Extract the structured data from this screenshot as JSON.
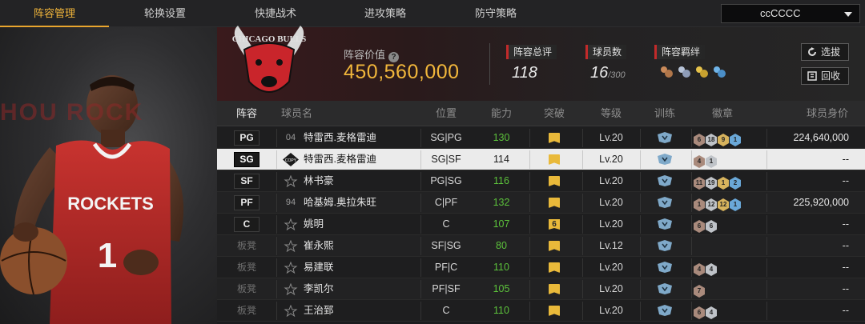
{
  "nav": {
    "tabs": [
      {
        "label": "阵容管理",
        "active": true
      },
      {
        "label": "轮换设置",
        "active": false
      },
      {
        "label": "快捷战术",
        "active": false
      },
      {
        "label": "进攻策略",
        "active": false
      },
      {
        "label": "防守策略",
        "active": false
      }
    ],
    "team_select": "ccCCCC"
  },
  "player_panel": {
    "jersey_team": "ROCKETS",
    "jersey_number": "1",
    "bg_text": "HOU  ROCK"
  },
  "header": {
    "logo_text": "CHICAGO BULLS",
    "lineup_value_label": "阵容价值",
    "lineup_value": "450,560,000",
    "rating_label": "阵容总评",
    "rating_value": "118",
    "players_label": "球员数",
    "players_value": "16",
    "players_max": "/300",
    "chemistry_label": "阵容羁绊",
    "chemistry_icons": [
      "chem-icon-1",
      "chem-icon-2",
      "chem-icon-3",
      "chem-icon-4"
    ],
    "buttons": {
      "select": "选拔",
      "recycle": "回收"
    }
  },
  "table": {
    "headers": [
      "阵容",
      "球员名",
      "位置",
      "能力",
      "突破",
      "等级",
      "训练",
      "徽章",
      "球员身价"
    ],
    "rows": [
      {
        "slot": "PG",
        "starter": true,
        "num": "04",
        "name": "特雷西.麦格雷迪",
        "position": "SG|PG",
        "ability": "130",
        "ability_green": true,
        "breakthrough": "",
        "level": "Lv.20",
        "badges": [
          {
            "t": "bronze",
            "v": "6"
          },
          {
            "t": "silver",
            "v": "18"
          },
          {
            "t": "gold",
            "v": "9"
          },
          {
            "t": "blue",
            "v": "1"
          }
        ],
        "salary": "224,640,000"
      },
      {
        "slot": "SG",
        "starter": true,
        "num": "COPY",
        "name": "特雷西.麦格雷迪",
        "position": "SG|SF",
        "ability": "114",
        "ability_green": false,
        "breakthrough": "",
        "level": "Lv.20",
        "badges": [
          {
            "t": "bronze",
            "v": "4"
          },
          {
            "t": "silver",
            "v": "1"
          }
        ],
        "salary": "--",
        "selected": true
      },
      {
        "slot": "SF",
        "starter": true,
        "num": "",
        "name": "林书豪",
        "position": "PG|SG",
        "ability": "116",
        "ability_green": true,
        "breakthrough": "",
        "level": "Lv.20",
        "badges": [
          {
            "t": "bronze",
            "v": "11"
          },
          {
            "t": "silver",
            "v": "19"
          },
          {
            "t": "gold",
            "v": "1"
          },
          {
            "t": "blue",
            "v": "2"
          }
        ],
        "salary": "--"
      },
      {
        "slot": "PF",
        "starter": true,
        "num": "94",
        "name": "哈基姆.奥拉朱旺",
        "position": "C|PF",
        "ability": "132",
        "ability_green": true,
        "breakthrough": "",
        "level": "Lv.20",
        "badges": [
          {
            "t": "bronze",
            "v": "1"
          },
          {
            "t": "silver",
            "v": "12"
          },
          {
            "t": "gold",
            "v": "12"
          },
          {
            "t": "blue",
            "v": "1"
          }
        ],
        "salary": "225,920,000"
      },
      {
        "slot": "C",
        "starter": true,
        "num": "",
        "name": "姚明",
        "position": "C",
        "ability": "107",
        "ability_green": true,
        "breakthrough": "6",
        "level": "Lv.20",
        "badges": [
          {
            "t": "bronze",
            "v": "6"
          },
          {
            "t": "silver",
            "v": "6"
          }
        ],
        "salary": "--"
      },
      {
        "slot": "板凳",
        "starter": false,
        "num": "",
        "name": "崔永熙",
        "position": "SF|SG",
        "ability": "80",
        "ability_green": true,
        "breakthrough": "",
        "level": "Lv.12",
        "badges": [],
        "salary": "--"
      },
      {
        "slot": "板凳",
        "starter": false,
        "num": "",
        "name": "易建联",
        "position": "PF|C",
        "ability": "110",
        "ability_green": true,
        "breakthrough": "",
        "level": "Lv.20",
        "badges": [
          {
            "t": "bronze",
            "v": "4"
          },
          {
            "t": "silver",
            "v": "4"
          }
        ],
        "salary": "--"
      },
      {
        "slot": "板凳",
        "starter": false,
        "num": "",
        "name": "李凯尔",
        "position": "PF|SF",
        "ability": "105",
        "ability_green": true,
        "breakthrough": "",
        "level": "Lv.20",
        "badges": [
          {
            "t": "bronze",
            "v": "7"
          }
        ],
        "salary": "--"
      },
      {
        "slot": "板凳",
        "starter": false,
        "num": "",
        "name": "王治郅",
        "position": "C",
        "ability": "110",
        "ability_green": true,
        "breakthrough": "",
        "level": "Lv.20",
        "badges": [
          {
            "t": "bronze",
            "v": "6"
          },
          {
            "t": "silver",
            "v": "4"
          }
        ],
        "salary": "--"
      }
    ]
  },
  "colors": {
    "accent": "#f1b63b",
    "green": "#5cc23b",
    "red": "#c22a2a"
  }
}
